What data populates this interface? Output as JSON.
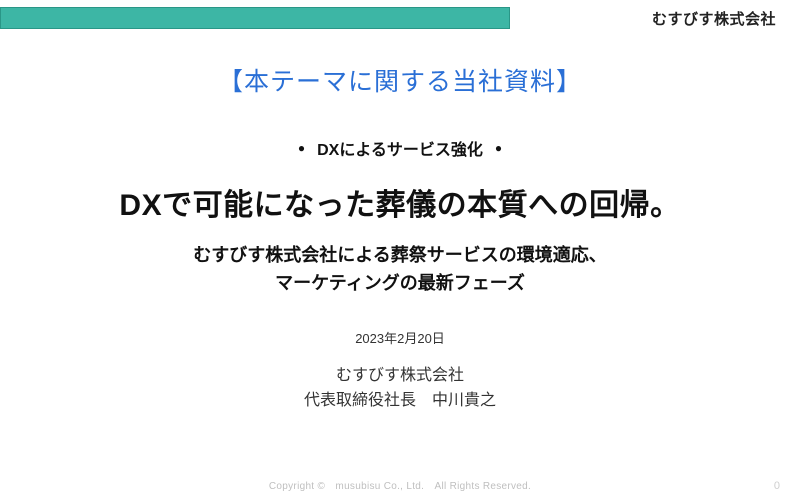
{
  "header": {
    "company_name": "むすびす株式会社"
  },
  "bracket_title": "【本テーマに関する当社資料】",
  "tagline": "DXによるサービス強化",
  "headline": "DXで可能になった葬儀の本質への回帰。",
  "subtitle_line1": "むすびす株式会社による葬祭サービスの環境適応、",
  "subtitle_line2": "マーケティングの最新フェーズ",
  "date": "2023年2月20日",
  "org": {
    "company": "むすびす株式会社",
    "title_name": "代表取締役社長　中川貴之"
  },
  "footer": {
    "copyright": "Copyright ©　musubisu Co., Ltd.　All Rights Reserved."
  },
  "page_number": "0"
}
